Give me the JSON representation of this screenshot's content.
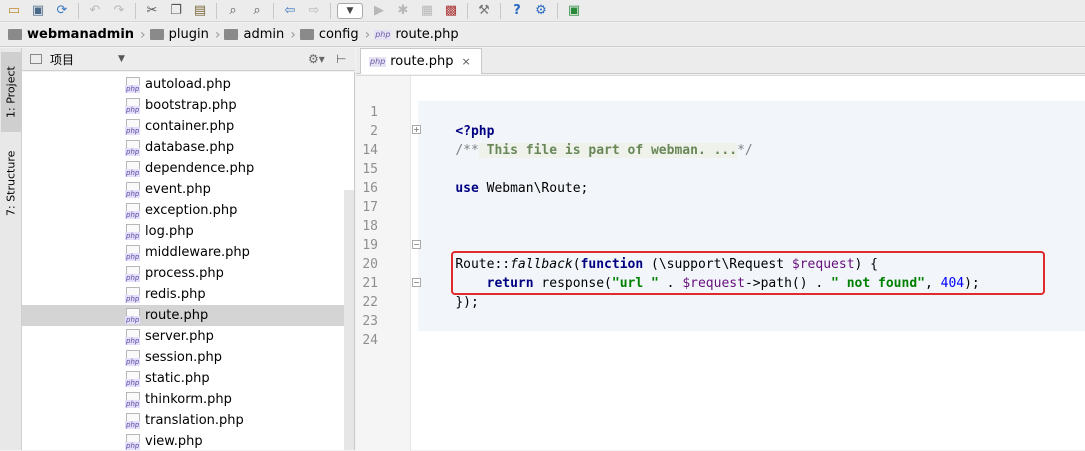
{
  "toolbar": {
    "icons": [
      "open-folder-icon",
      "save-icon",
      "sync-icon",
      "undo-icon",
      "redo-icon",
      "cut-icon",
      "copy-icon",
      "paste-icon",
      "find-icon",
      "find-replace-icon",
      "back-icon",
      "forward-icon",
      "run-config-dropdown",
      "run-icon",
      "debug-icon",
      "coverage-icon",
      "stop-icon",
      "settings-icon",
      "help-icon",
      "php-icon",
      "sdk-icon"
    ]
  },
  "breadcrumb": [
    {
      "label": "webmanadmin",
      "bold": true
    },
    {
      "label": "plugin"
    },
    {
      "label": "admin"
    },
    {
      "label": "config"
    },
    {
      "label": "route.php",
      "file": true
    }
  ],
  "side": {
    "project_tab": "1: Project",
    "structure_tab": "7: Structure"
  },
  "project": {
    "header_label": "项目",
    "files": [
      "autoload.php",
      "bootstrap.php",
      "container.php",
      "database.php",
      "dependence.php",
      "event.php",
      "exception.php",
      "log.php",
      "middleware.php",
      "process.php",
      "redis.php",
      "route.php",
      "server.php",
      "session.php",
      "static.php",
      "thinkorm.php",
      "translation.php",
      "view.php"
    ],
    "selected": "route.php",
    "file_badge": "php"
  },
  "editor": {
    "tab_label": "route.php",
    "tab_close": "×",
    "line_numbers": [
      "1",
      "2",
      "14",
      "15",
      "16",
      "17",
      "18",
      "19",
      "20",
      "21",
      "22",
      "23",
      "24"
    ],
    "code": {
      "l1": "<?php",
      "l2_open": "/**",
      "l2_text": " This file is part of webman. ...",
      "l2_close": "*/",
      "l15_kw": "use",
      "l15_rest": " Webman\\Route;",
      "l19_a": "Route::",
      "l19_b": "fallback",
      "l19_c": "(",
      "l19_kw": "function",
      "l19_d": " (\\support\\Request ",
      "l19_var": "$request",
      "l19_e": ") {",
      "l20_indent": "    ",
      "l20_kw": "return",
      "l20_a": " response(",
      "l20_s1": "\"url \"",
      "l20_b": " . ",
      "l20_var": "$request",
      "l20_c": "->path() . ",
      "l20_s2": "\" not found\"",
      "l20_d": ", ",
      "l20_num": "404",
      "l20_e": ");",
      "l21": "});"
    }
  }
}
